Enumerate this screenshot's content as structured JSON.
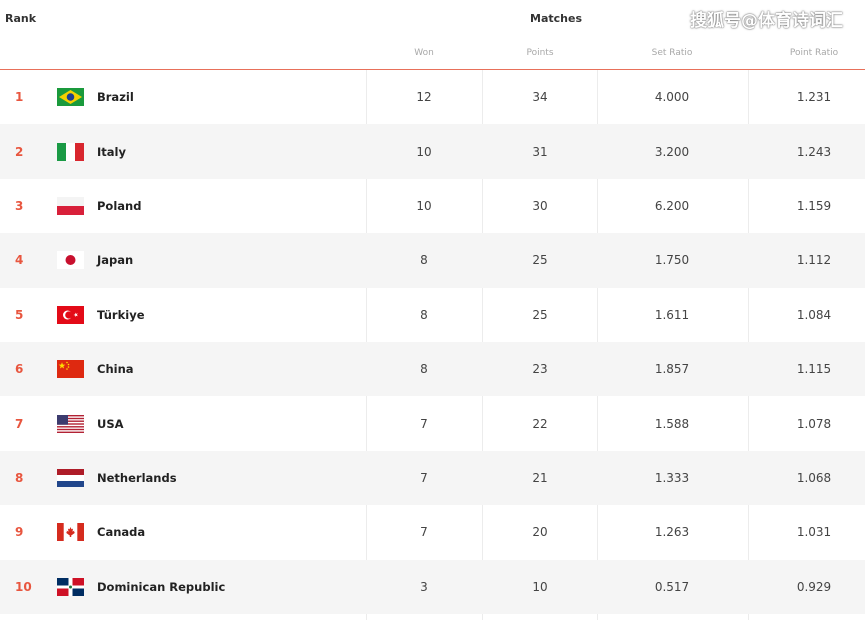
{
  "header": {
    "rank_label": "Rank",
    "matches_label": "Matches",
    "watermark": "搜狐号@体育诗词汇",
    "columns": {
      "won": "Won",
      "points": "Points",
      "set_ratio": "Set Ratio",
      "point_ratio": "Point Ratio"
    }
  },
  "rows": [
    {
      "rank": "1",
      "team": "Brazil",
      "flag_icon": "brazil-flag-icon",
      "won": "12",
      "points": "34",
      "set_ratio": "4.000",
      "point_ratio": "1.231"
    },
    {
      "rank": "2",
      "team": "Italy",
      "flag_icon": "italy-flag-icon",
      "won": "10",
      "points": "31",
      "set_ratio": "3.200",
      "point_ratio": "1.243"
    },
    {
      "rank": "3",
      "team": "Poland",
      "flag_icon": "poland-flag-icon",
      "won": "10",
      "points": "30",
      "set_ratio": "6.200",
      "point_ratio": "1.159"
    },
    {
      "rank": "4",
      "team": "Japan",
      "flag_icon": "japan-flag-icon",
      "won": "8",
      "points": "25",
      "set_ratio": "1.750",
      "point_ratio": "1.112"
    },
    {
      "rank": "5",
      "team": "Türkiye",
      "flag_icon": "turkiye-flag-icon",
      "won": "8",
      "points": "25",
      "set_ratio": "1.611",
      "point_ratio": "1.084"
    },
    {
      "rank": "6",
      "team": "China",
      "flag_icon": "china-flag-icon",
      "won": "8",
      "points": "23",
      "set_ratio": "1.857",
      "point_ratio": "1.115"
    },
    {
      "rank": "7",
      "team": "USA",
      "flag_icon": "usa-flag-icon",
      "won": "7",
      "points": "22",
      "set_ratio": "1.588",
      "point_ratio": "1.078"
    },
    {
      "rank": "8",
      "team": "Netherlands",
      "flag_icon": "netherlands-flag-icon",
      "won": "7",
      "points": "21",
      "set_ratio": "1.333",
      "point_ratio": "1.068"
    },
    {
      "rank": "9",
      "team": "Canada",
      "flag_icon": "canada-flag-icon",
      "won": "7",
      "points": "20",
      "set_ratio": "1.263",
      "point_ratio": "1.031"
    },
    {
      "rank": "10",
      "team": "Dominican Republic",
      "flag_icon": "dominican-republic-flag-icon",
      "won": "3",
      "points": "10",
      "set_ratio": "0.517",
      "point_ratio": "0.929"
    }
  ],
  "colors": {
    "accent": "#e8563f",
    "header_line": "#e8705a",
    "row_alt": "#f5f5f5"
  }
}
